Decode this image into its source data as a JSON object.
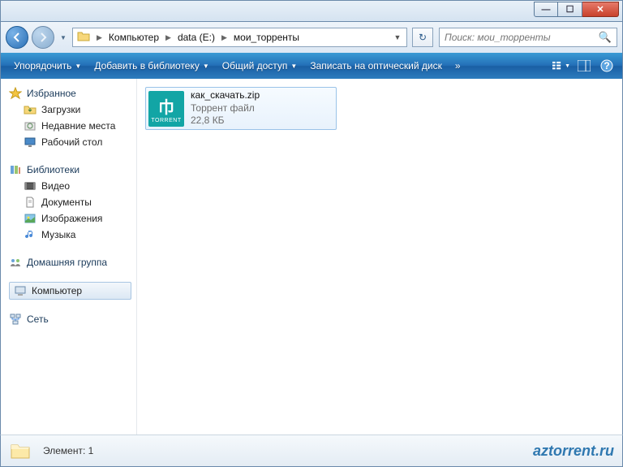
{
  "breadcrumb": {
    "parts": [
      "Компьютер",
      "data (E:)",
      "мои_торренты"
    ]
  },
  "search": {
    "placeholder": "Поиск: мои_торренты"
  },
  "toolbar": {
    "organize": "Упорядочить",
    "addlib": "Добавить в библиотеку",
    "share": "Общий доступ",
    "burn": "Записать на оптический диск",
    "overflow": "»"
  },
  "sidebar": {
    "favorites": {
      "label": "Избранное",
      "items": [
        "Загрузки",
        "Недавние места",
        "Рабочий стол"
      ]
    },
    "libraries": {
      "label": "Библиотеки",
      "items": [
        "Видео",
        "Документы",
        "Изображения",
        "Музыка"
      ]
    },
    "homegroup": {
      "label": "Домашняя группа"
    },
    "computer": {
      "label": "Компьютер"
    },
    "network": {
      "label": "Сеть"
    }
  },
  "file": {
    "name": "как_скачать.zip",
    "type": "Торрент файл",
    "size": "22,8 КБ",
    "icon_label": "TORRENT"
  },
  "status": {
    "text": "Элемент: 1"
  },
  "watermark": "aztorrent.ru"
}
